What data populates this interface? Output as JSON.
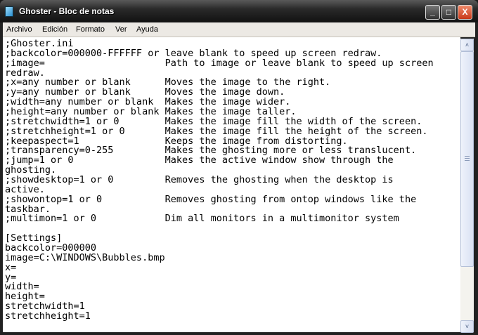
{
  "window": {
    "title": "Ghoster - Bloc de notas",
    "minimize": "_",
    "maximize": "□",
    "close": "X"
  },
  "menu": [
    "Archivo",
    "Edición",
    "Formato",
    "Ver",
    "Ayuda"
  ],
  "document": {
    "lines": [
      ";Ghoster.ini",
      ";backcolor=000000-FFFFFF or leave blank to speed up screen redraw.",
      ";image=                     Path to image or leave blank to speed up screen",
      "redraw.",
      ";x=any number or blank      Moves the image to the right.",
      ";y=any number or blank      Moves the image down.",
      ";width=any number or blank  Makes the image wider.",
      ";height=any number or blank Makes the image taller.",
      ";stretchwidth=1 or 0        Makes the image fill the width of the screen.",
      ";stretchheight=1 or 0       Makes the image fill the height of the screen.",
      ";keepaspect=1               Keeps the image from distorting.",
      ";transparency=0-255         Makes the ghosting more or less translucent.",
      ";jump=1 or 0                Makes the active window show through the",
      "ghosting.",
      ";showdesktop=1 or 0         Removes the ghosting when the desktop is",
      "active.",
      ";showontop=1 or 0           Removes ghosting from ontop windows like the",
      "taskbar.",
      ";multimon=1 or 0            Dim all monitors in a multimonitor system",
      "",
      "[Settings]",
      "backcolor=000000",
      "image=C:\\WINDOWS\\Bubbles.bmp",
      "x=",
      "y=",
      "width=",
      "height=",
      "stretchwidth=1",
      "stretchheight=1"
    ]
  },
  "scrollbar": {
    "up": "˄",
    "down": "˅",
    "position": 0.0
  }
}
